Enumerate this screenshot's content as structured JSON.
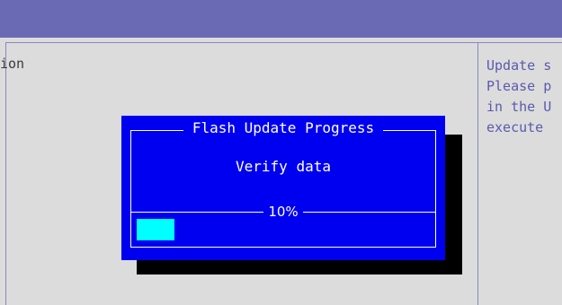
{
  "background": {
    "left_panel_text": "ion",
    "help_lines": [
      "Update s",
      "Please p",
      "in the U",
      "execute"
    ]
  },
  "dialog": {
    "title": "Flash Update Progress",
    "status": "Verify data",
    "progress_label": "10%",
    "progress_fraction": 0.13
  },
  "colors": {
    "dialog_bg": "#0000f0",
    "progress_fill": "#00ffff",
    "header_bar": "#6a6ab4",
    "screen_bg": "#dcdcdc",
    "help_text": "#5a5ab0"
  }
}
